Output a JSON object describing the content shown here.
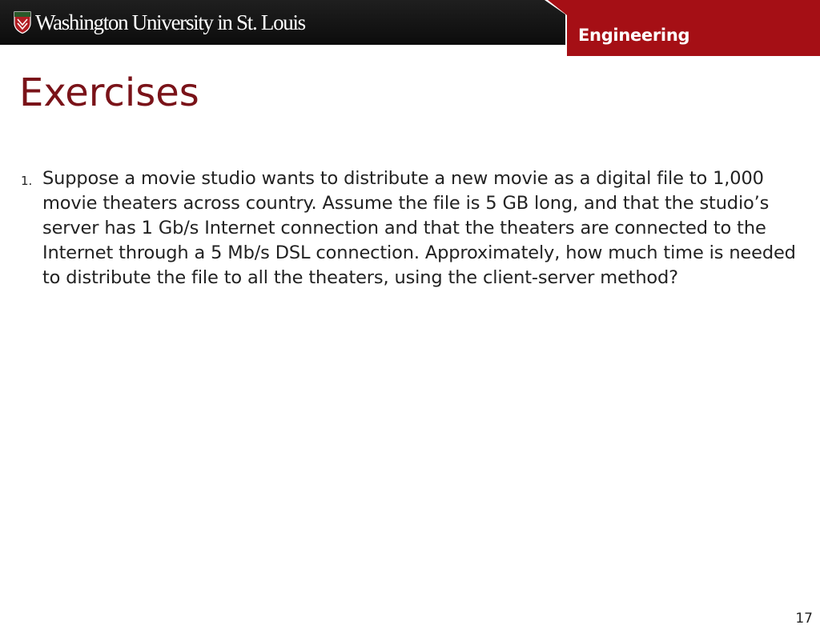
{
  "header": {
    "university_name": "Washington University in St. Louis",
    "school_label": "Engineering"
  },
  "slide": {
    "title": "Exercises",
    "exercises": [
      {
        "number": "1.",
        "text": "Suppose a movie studio wants to distribute a new movie as a digital file to 1,000 movie theaters across country. Assume the file is 5 GB long, and that the studio’s server has 1 Gb/s Internet connection and that the theaters are connected to the Internet through a 5 Mb/s DSL connection. Approximately, how much time is needed to distribute the file to all the theaters, using the client-server method?"
      }
    ],
    "page_number": "17"
  },
  "colors": {
    "header_background": "#111111",
    "engineering_tab": "#a50f15",
    "title": "#7a1319",
    "body_text": "#222222"
  }
}
